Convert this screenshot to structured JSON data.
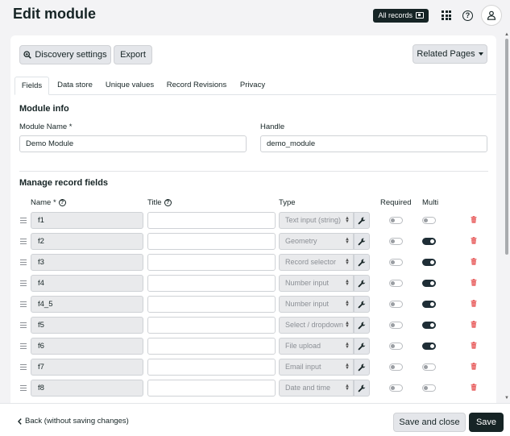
{
  "header": {
    "title": "Edit module",
    "all_records_label": "All records"
  },
  "toolbar": {
    "discovery_label": "Discovery settings",
    "export_label": "Export",
    "related_label": "Related Pages"
  },
  "tabs": [
    {
      "label": "Fields",
      "active": true
    },
    {
      "label": "Data store",
      "active": false
    },
    {
      "label": "Unique values",
      "active": false
    },
    {
      "label": "Record Revisions",
      "active": false
    },
    {
      "label": "Privacy",
      "active": false
    }
  ],
  "module_info": {
    "section_title": "Module info",
    "name_label": "Module Name *",
    "name_value": "Demo Module",
    "handle_label": "Handle",
    "handle_value": "demo_module"
  },
  "fields": {
    "section_title": "Manage record fields",
    "columns": {
      "name": "Name *",
      "title": "Title",
      "type": "Type",
      "required": "Required",
      "multi": "Multi"
    },
    "rows": [
      {
        "name": "f1",
        "title": "",
        "type": "Text input (string)",
        "required": false,
        "multi": false
      },
      {
        "name": "f2",
        "title": "",
        "type": "Geometry",
        "required": false,
        "multi": true
      },
      {
        "name": "f3",
        "title": "",
        "type": "Record selector",
        "required": false,
        "multi": true
      },
      {
        "name": "f4",
        "title": "",
        "type": "Number input",
        "required": false,
        "multi": true
      },
      {
        "name": "f4_5",
        "title": "",
        "type": "Number input",
        "required": false,
        "multi": true
      },
      {
        "name": "f5",
        "title": "",
        "type": "Select / dropdown",
        "required": false,
        "multi": true
      },
      {
        "name": "f6",
        "title": "",
        "type": "File upload",
        "required": false,
        "multi": true
      },
      {
        "name": "f7",
        "title": "",
        "type": "Email input",
        "required": false,
        "multi": false
      },
      {
        "name": "f8",
        "title": "",
        "type": "Date and time",
        "required": false,
        "multi": false
      }
    ]
  },
  "footer": {
    "back_label": "Back (without saving changes)",
    "save_close_label": "Save and close",
    "save_label": "Save"
  },
  "colors": {
    "primary": "#162425",
    "danger": "#e54b4b",
    "background": "#f3f3f5"
  }
}
